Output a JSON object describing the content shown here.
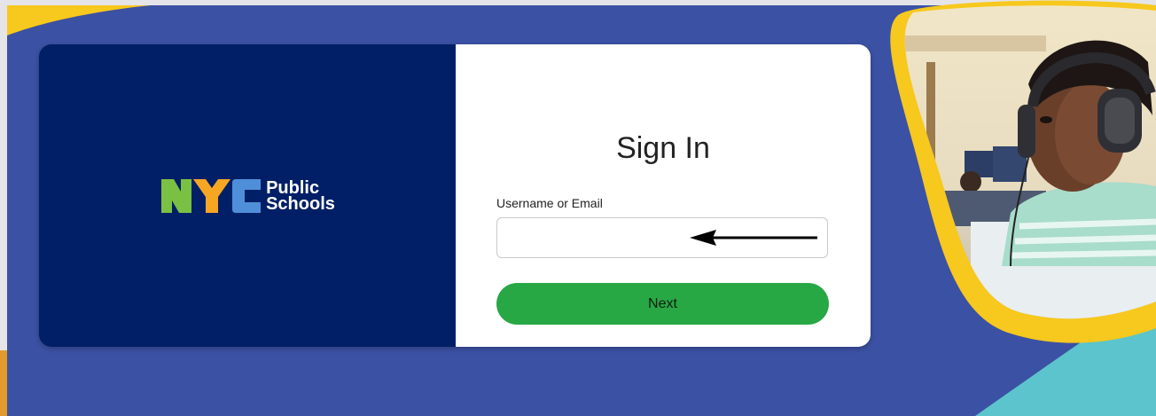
{
  "colors": {
    "page_background": "#3b51a3",
    "brand_navy": "#001f66",
    "frame_yellow": "#f7c81d",
    "accent_teal": "#5bc4cc",
    "button_green": "#28a745",
    "logo_green": "#7ac143",
    "logo_orange": "#f5a623",
    "logo_blue": "#4f8fd9"
  },
  "brand": {
    "logo_mark": "NYC",
    "logo_line1": "Public",
    "logo_line2": "Schools"
  },
  "signin": {
    "title": "Sign In",
    "username_label": "Username or Email",
    "username_value": "",
    "username_placeholder": "",
    "next_label": "Next"
  },
  "annotation": {
    "icon": "arrow-left-icon"
  },
  "hero_photo": {
    "icon": "student-with-headphones-photo"
  }
}
